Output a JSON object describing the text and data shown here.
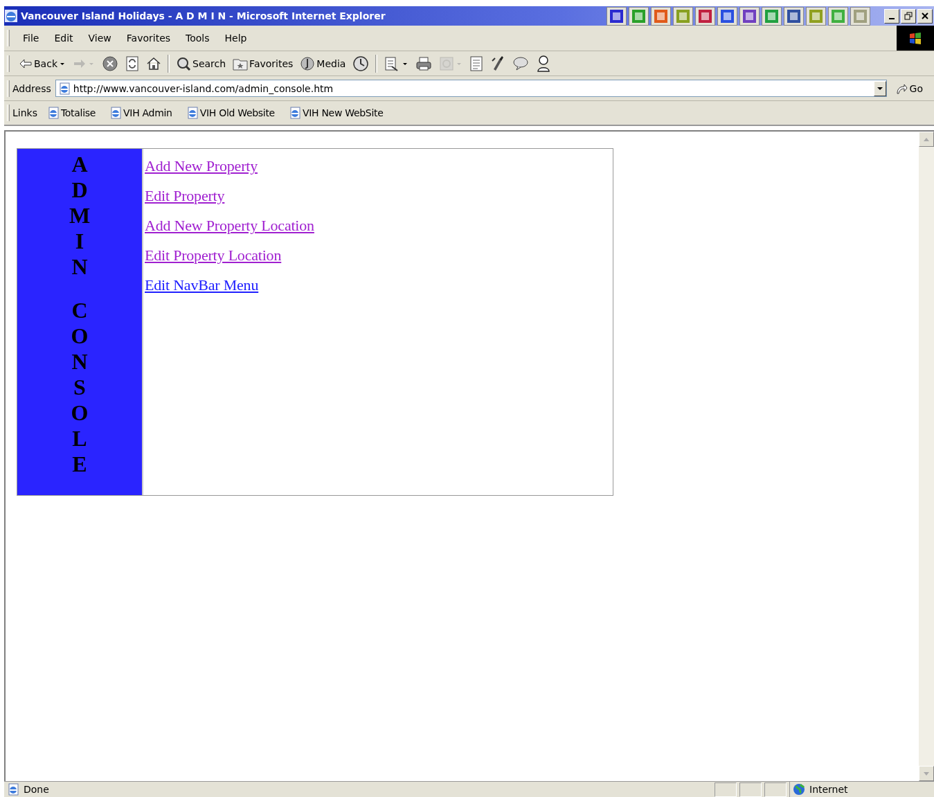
{
  "window": {
    "title": "Vancouver Island Holidays - A D M I N - Microsoft Internet Explorer"
  },
  "menu": [
    "File",
    "Edit",
    "View",
    "Favorites",
    "Tools",
    "Help"
  ],
  "toolbar": [
    [
      {
        "kind": "back",
        "label": "Back",
        "dropdown": true,
        "disabled": false
      },
      {
        "kind": "forward",
        "dropdown": true,
        "disabled": true
      },
      {
        "kind": "stop",
        "dropdown": false,
        "disabled": false
      },
      {
        "kind": "refresh",
        "dropdown": false,
        "disabled": false
      },
      {
        "kind": "home",
        "dropdown": false,
        "disabled": false
      }
    ],
    [
      {
        "kind": "search",
        "label": "Search",
        "dropdown": false,
        "disabled": false
      },
      {
        "kind": "favorites",
        "label": "Favorites",
        "dropdown": false,
        "disabled": false
      },
      {
        "kind": "media",
        "label": "Media",
        "dropdown": false,
        "disabled": false
      },
      {
        "kind": "history",
        "dropdown": false,
        "disabled": false
      }
    ],
    [
      {
        "kind": "mail",
        "dropdown": true,
        "disabled": false
      },
      {
        "kind": "print",
        "dropdown": false,
        "disabled": false
      },
      {
        "kind": "edit",
        "dropdown": true,
        "disabled": true
      },
      {
        "kind": "document",
        "dropdown": false,
        "disabled": false
      },
      {
        "kind": "brush",
        "dropdown": false,
        "disabled": false
      },
      {
        "kind": "discuss",
        "dropdown": false,
        "disabled": false
      },
      {
        "kind": "person",
        "dropdown": false,
        "disabled": false
      }
    ]
  ],
  "address": {
    "label": "Address",
    "value": "http://www.vancouver-island.com/admin_console.htm",
    "go": "Go"
  },
  "links": {
    "label": "Links",
    "items": [
      "Totalise",
      "VIH Admin",
      "VIH Old Website",
      "VIH New WebSite"
    ]
  },
  "page": {
    "banner": [
      "ADMIN",
      "CONSOLE"
    ],
    "links": [
      {
        "text": "Add New Property",
        "visited": true
      },
      {
        "text": "Edit Property",
        "visited": true
      },
      {
        "text": "Add New Property Location",
        "visited": true
      },
      {
        "text": "Edit Property Location",
        "visited": true
      },
      {
        "text": "Edit NavBar Menu",
        "visited": false
      }
    ]
  },
  "status": {
    "text": "Done",
    "zone": "Internet"
  }
}
